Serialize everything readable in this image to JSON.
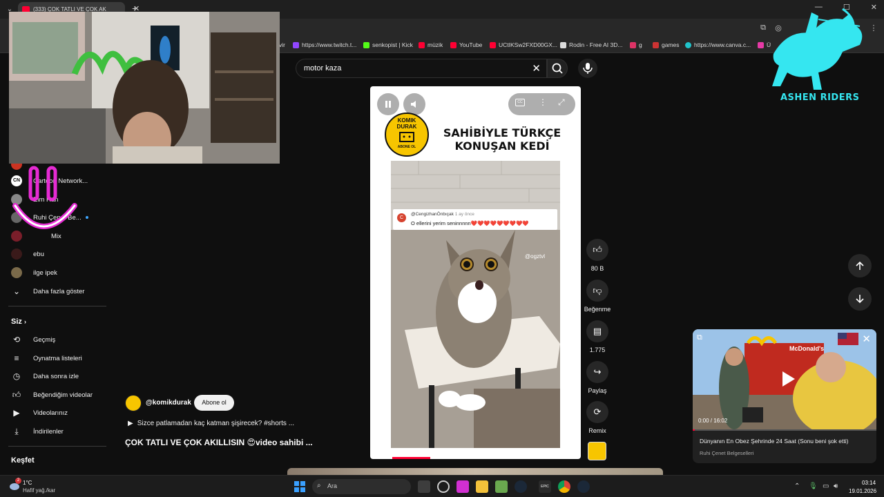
{
  "browser": {
    "tab_title": "(333) ÇOK TATLI VE ÇOK AK",
    "bookmarks": [
      {
        "label": "vir",
        "color": "#888888"
      },
      {
        "label": "https://www.twitch.t...",
        "color": "#9146ff"
      },
      {
        "label": "senkopist | Kick",
        "color": "#53fc18"
      },
      {
        "label": "müzik",
        "color": "#ff0033"
      },
      {
        "label": "YouTube",
        "color": "#ff0033"
      },
      {
        "label": "UCtIKSw2FXD00GX...",
        "color": "#ff0033"
      },
      {
        "label": "Rodin - Free AI 3D...",
        "color": "#dddddd"
      },
      {
        "label": "g",
        "color": "#dd3366"
      },
      {
        "label": "games",
        "color": "#cc3333"
      },
      {
        "label": "https://www.canva.c...",
        "color": "#20c4cb"
      },
      {
        "label": "Ü",
        "color": "#e63aa6"
      }
    ]
  },
  "search": {
    "query": "motor kaza"
  },
  "sidebar": {
    "subscriptions": [
      {
        "label": "Cartoon Network...",
        "color": "#ffffff"
      },
      {
        "label": "Elm Han",
        "color": "#888888"
      },
      {
        "label": "Ruhi Çenet Be...",
        "color": "#666666"
      },
      {
        "label": "Mix",
        "color": "#7a1e2a"
      },
      {
        "label": "ebu",
        "color": "#3a1a1a"
      },
      {
        "label": "ilge ipek",
        "color": "#7a6a4a"
      }
    ],
    "show_more": "Daha fazla göster",
    "you_title": "Siz",
    "you_items": [
      {
        "label": "Geçmiş",
        "icon": "history-icon"
      },
      {
        "label": "Oynatma listeleri",
        "icon": "playlist-icon"
      },
      {
        "label": "Daha sonra izle",
        "icon": "clock-icon"
      },
      {
        "label": "Beğendiğim videolar",
        "icon": "thumbs-up-icon"
      },
      {
        "label": "Videolarınız",
        "icon": "video-icon"
      },
      {
        "label": "İndirilenler",
        "icon": "download-icon"
      }
    ],
    "explore_title": "Keşfet"
  },
  "short": {
    "title_line1": "SAHİBİYLE TÜRKÇE",
    "title_line2": "KONUŞAN KEDİ",
    "logo_line1": "KOMIK",
    "logo_line2": "DURAK",
    "logo_line3": "ABONE OL",
    "comment_user": "@CengizhanÖnbıçak",
    "comment_time": "1 ay önce",
    "comment_text": "O ellerini yerim seninnnnn❤️❤️❤️❤️❤️❤️❤️❤️❤️",
    "watermark": "@ogztvl",
    "progress": 0.18
  },
  "actions": {
    "like_count": "80 B",
    "dislike_label": "Beğenme",
    "comment_count": "1.775",
    "share_label": "Paylaş",
    "remix_label": "Remix"
  },
  "channel": {
    "handle": "@komikdurak",
    "subscribe_label": "Abone ol",
    "question": "Sizce patlamadan kaç katman şişirecek? #shorts ...",
    "caption": "ÇOK TATLI VE ÇOK AKILLISIN 😍video sahibi ..."
  },
  "mini_player": {
    "time": "0:00 / 16:02",
    "title": "Dünyanın En Obez Şehrinde 24 Saat (Sonu beni şok etti)",
    "channel": "Ruhi Çenet Belgeselleri",
    "sign_text": "McDonald's"
  },
  "overlay": {
    "ashen_text": "ASHEN RIDERS"
  },
  "taskbar": {
    "temperature": "1°C",
    "weather": "Hafif yağ./kar",
    "search_placeholder": "Ara",
    "time": "03:14",
    "date": "19.01.2026",
    "weather_badge": "2"
  }
}
